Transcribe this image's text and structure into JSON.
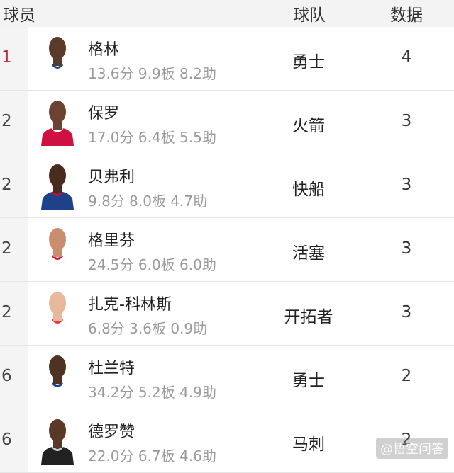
{
  "header": {
    "player": "球员",
    "team": "球队",
    "stat": "数据"
  },
  "rows": [
    {
      "rank": "1",
      "name": "格林",
      "line": "13.6分 9.9板 8.2助",
      "team": "勇士",
      "value": "4",
      "skin": "#5a3a28",
      "jersey": "#ffffff",
      "trim": "#1d428a"
    },
    {
      "rank": "2",
      "name": "保罗",
      "line": "17.0分 6.4板 5.5助",
      "team": "火箭",
      "value": "3",
      "skin": "#6a4430",
      "jersey": "#ce1141",
      "trim": "#ffffff"
    },
    {
      "rank": "2",
      "name": "贝弗利",
      "line": "9.8分 8.0板 4.7助",
      "team": "快船",
      "value": "3",
      "skin": "#4a2c1e",
      "jersey": "#1d428a",
      "trim": "#c8102e"
    },
    {
      "rank": "2",
      "name": "格里芬",
      "line": "24.5分 6.0板 6.0助",
      "team": "活塞",
      "value": "3",
      "skin": "#c98e6e",
      "jersey": "#ffffff",
      "trim": "#c8102e"
    },
    {
      "rank": "2",
      "name": "扎克-科林斯",
      "line": "6.8分 3.6板 0.9助",
      "team": "开拓者",
      "value": "3",
      "skin": "#e7b89a",
      "jersey": "#ffffff",
      "trim": "#e03a3e"
    },
    {
      "rank": "6",
      "name": "杜兰特",
      "line": "34.2分 5.2板 4.9助",
      "team": "勇士",
      "value": "2",
      "skin": "#4e3222",
      "jersey": "#ffffff",
      "trim": "#1d428a"
    },
    {
      "rank": "6",
      "name": "德罗赞",
      "line": "22.0分 6.7板 4.6助",
      "team": "马刺",
      "value": "2",
      "skin": "#5a3826",
      "jersey": "#222222",
      "trim": "#c4ced4"
    }
  ],
  "watermark": "@悟空问答"
}
